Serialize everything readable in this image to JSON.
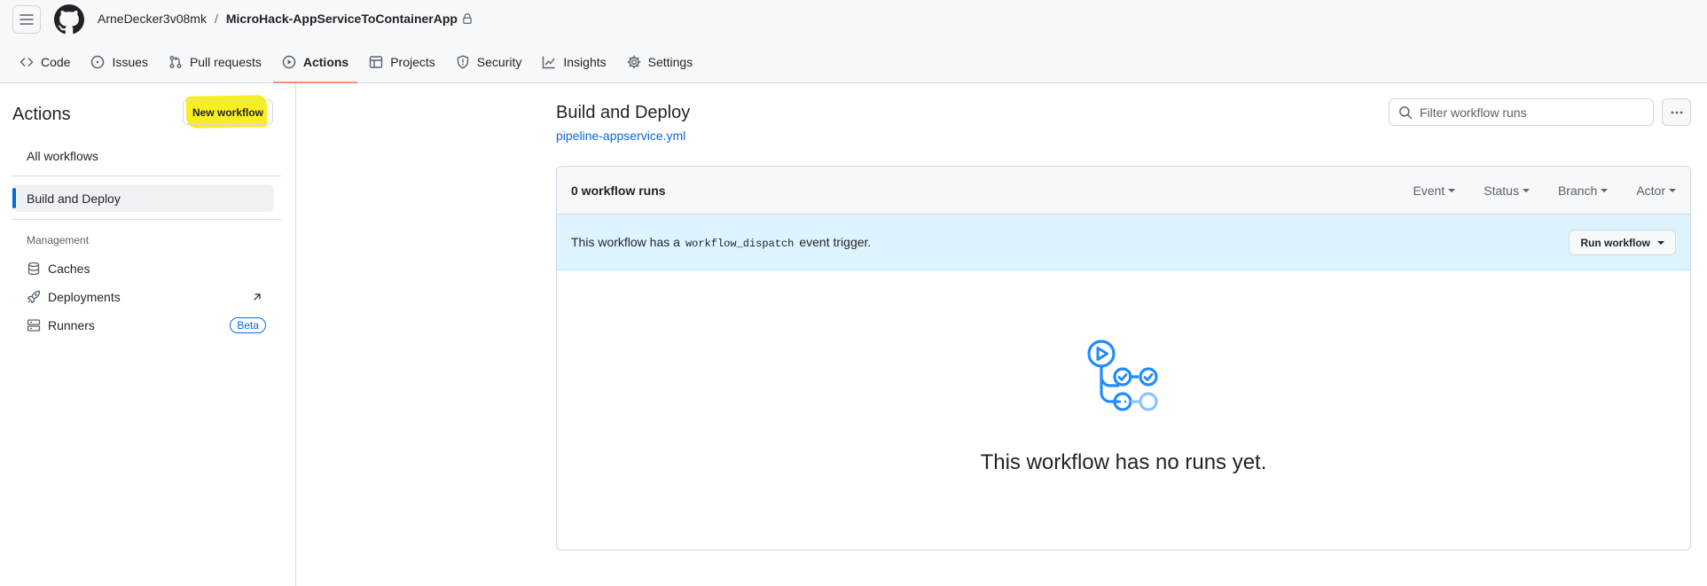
{
  "header": {
    "owner": "ArneDecker3v08mk",
    "separator": "/",
    "repo": "MicroHack-AppServiceToContainerApp",
    "tabs": [
      {
        "label": "Code",
        "icon": "code-icon"
      },
      {
        "label": "Issues",
        "icon": "issue-opened-icon"
      },
      {
        "label": "Pull requests",
        "icon": "git-pull-request-icon"
      },
      {
        "label": "Actions",
        "icon": "play-icon",
        "active": true
      },
      {
        "label": "Projects",
        "icon": "table-icon"
      },
      {
        "label": "Security",
        "icon": "shield-icon"
      },
      {
        "label": "Insights",
        "icon": "graph-icon"
      },
      {
        "label": "Settings",
        "icon": "gear-icon"
      }
    ]
  },
  "sidebar": {
    "title": "Actions",
    "new_workflow": "New workflow",
    "all_workflows": "All workflows",
    "workflow": "Build and Deploy",
    "management_label": "Management",
    "management": [
      {
        "label": "Caches",
        "icon": "database-icon"
      },
      {
        "label": "Deployments",
        "icon": "rocket-icon"
      },
      {
        "label": "Runners",
        "icon": "server-icon",
        "badge": "Beta"
      }
    ]
  },
  "main": {
    "title": "Build and Deploy",
    "file": "pipeline-appservice.yml",
    "filter_placeholder": "Filter workflow runs",
    "runs_count": "0 workflow runs",
    "filters": [
      "Event",
      "Status",
      "Branch",
      "Actor"
    ],
    "dispatch_prefix": "This workflow has a",
    "dispatch_code": "workflow_dispatch",
    "dispatch_suffix": "event trigger.",
    "run_workflow": "Run workflow",
    "empty_message": "This workflow has no runs yet."
  },
  "colors": {
    "accent_blue": "#0969da",
    "active_tab_underline": "#fd8c73",
    "highlight_yellow": "#f9ef20",
    "dispatch_bg": "#ddf4ff"
  }
}
